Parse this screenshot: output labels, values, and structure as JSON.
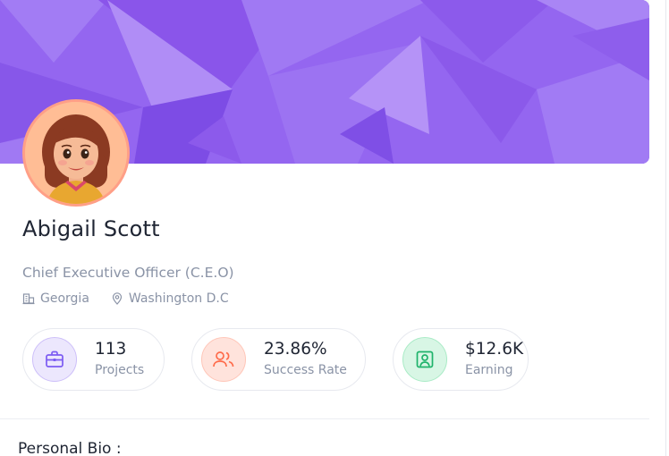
{
  "profile": {
    "name": "Abigail Scott",
    "designation": "Chief Executive Officer (C.E.O)",
    "company_icon": "building-icon",
    "company": "Georgia",
    "location_icon": "map-pin-icon",
    "location": "Washington D.C"
  },
  "stats": [
    {
      "value": "113",
      "label": "Projects",
      "icon": "briefcase-icon",
      "color": "#7c5cf2",
      "bg": "#ece7fd"
    },
    {
      "value": "23.86%",
      "label": "Success Rate",
      "icon": "users-icon",
      "color": "#ff6b4a",
      "bg": "#ffe3dc"
    },
    {
      "value": "$12.6K",
      "label": "Earning",
      "icon": "user-badge-icon",
      "color": "#1fb36b",
      "bg": "#d8f6e5"
    }
  ],
  "section": {
    "bio_title": "Personal Bio :"
  },
  "colors": {
    "banner": "#9466f0",
    "accent": "#7c5cf2"
  }
}
